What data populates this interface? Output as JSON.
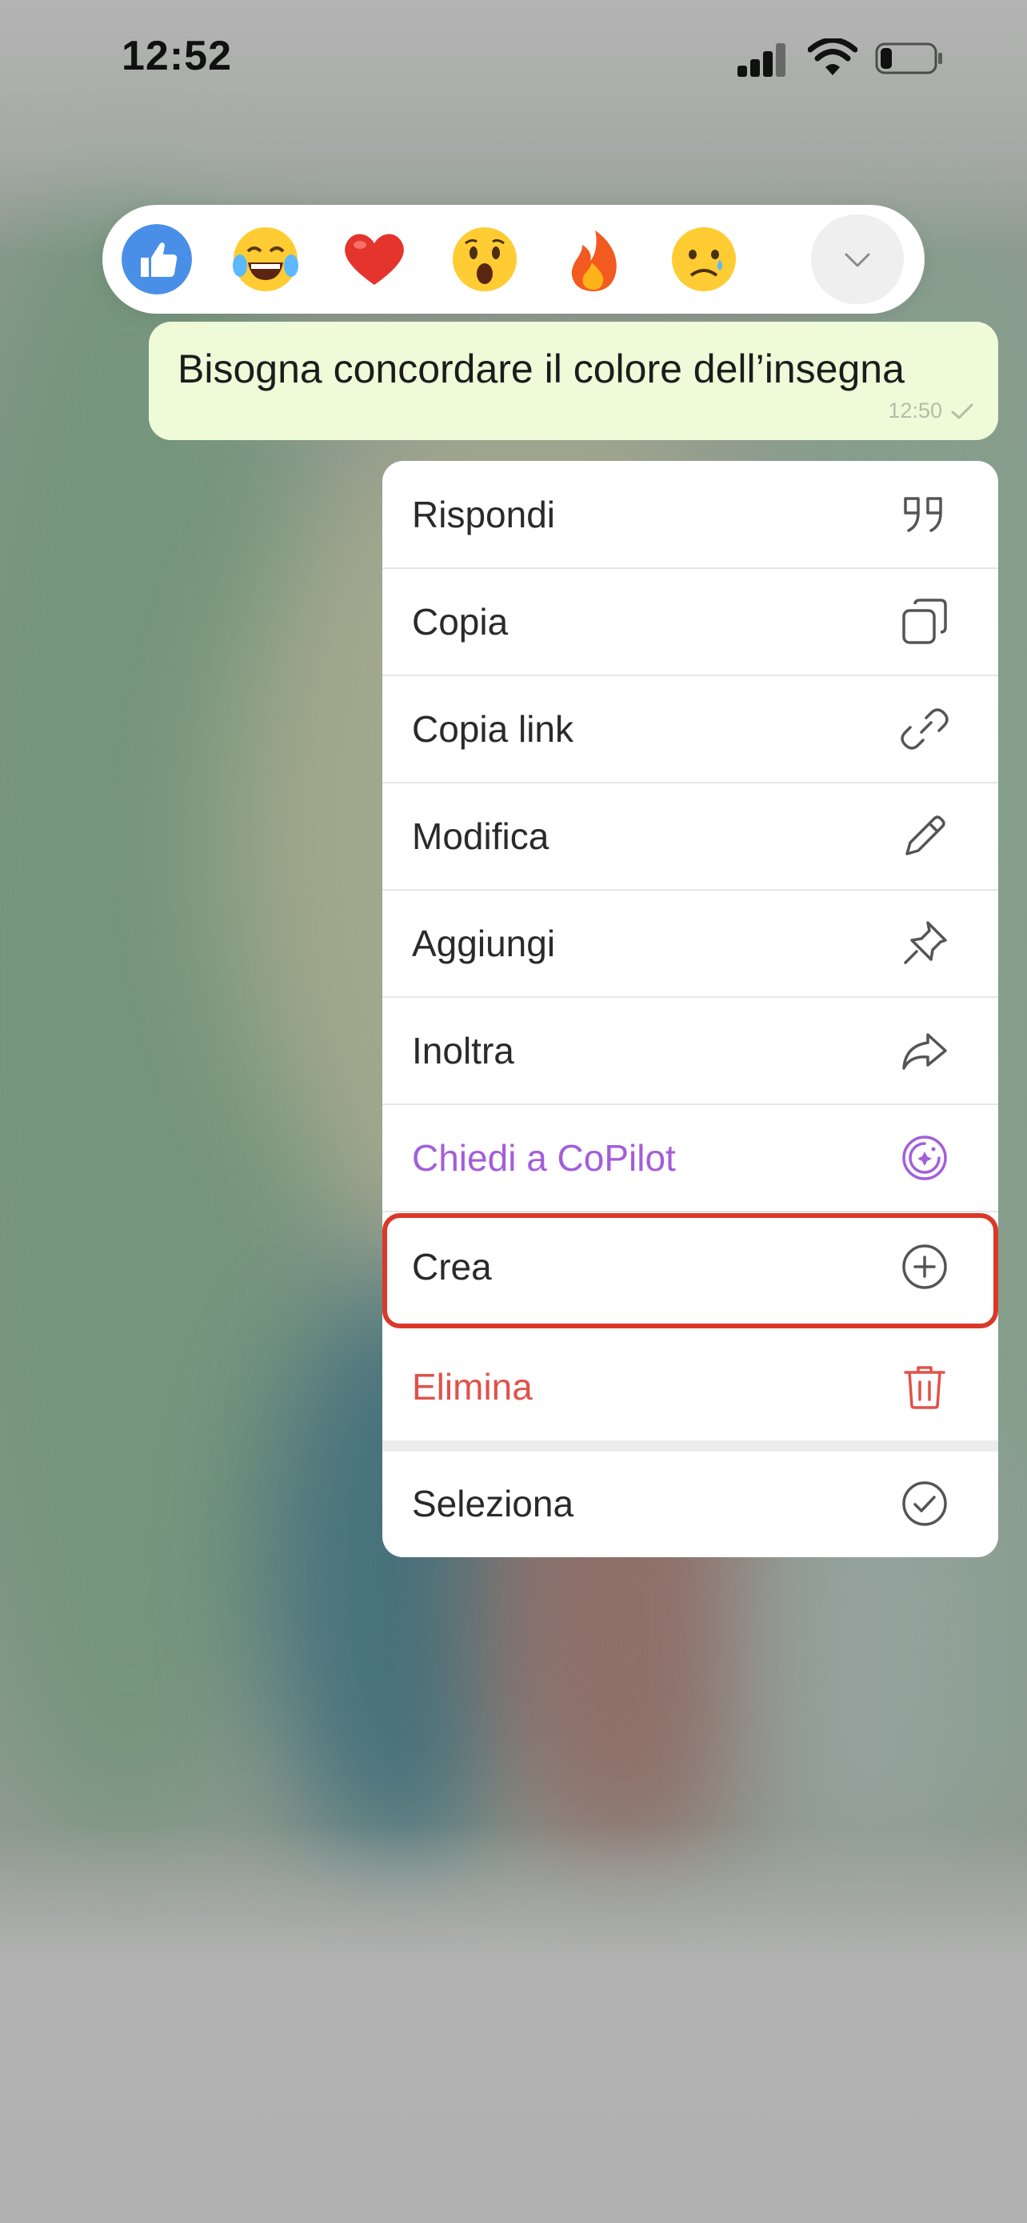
{
  "status_bar": {
    "time": "12:52"
  },
  "reactions": [
    {
      "name": "thumbs-up",
      "glyph": "👍"
    },
    {
      "name": "face-with-tears-of-joy",
      "glyph": "😂"
    },
    {
      "name": "red-heart",
      "glyph": "❤️"
    },
    {
      "name": "face-with-open-mouth",
      "glyph": "😮"
    },
    {
      "name": "fire",
      "glyph": "🔥"
    },
    {
      "name": "sad-face",
      "glyph": "😥"
    }
  ],
  "message": {
    "text": "Bisogna concordare il colore dell’insegna",
    "time": "12:50",
    "bubble_color": "#eefad8"
  },
  "menu": {
    "items": [
      {
        "label": "Rispondi",
        "icon": "quote-icon",
        "color": "#2a2a2a"
      },
      {
        "label": "Copia",
        "icon": "copy-icon",
        "color": "#2a2a2a"
      },
      {
        "label": "Copia link",
        "icon": "link-icon",
        "color": "#2a2a2a"
      },
      {
        "label": "Modifica",
        "icon": "pencil-icon",
        "color": "#2a2a2a"
      },
      {
        "label": "Aggiungi",
        "icon": "pin-icon",
        "color": "#2a2a2a"
      },
      {
        "label": "Inoltra",
        "icon": "forward-icon",
        "color": "#2a2a2a"
      },
      {
        "label": "Chiedi a CoPilot",
        "icon": "copilot-icon",
        "color": "#a35ed9"
      },
      {
        "label": "Crea",
        "icon": "plus-circle-icon",
        "color": "#2a2a2a"
      },
      {
        "label": "Elimina",
        "icon": "trash-icon",
        "color": "#e0524a"
      },
      {
        "label": "Seleziona",
        "icon": "check-circle-icon",
        "color": "#2a2a2a"
      }
    ]
  },
  "colors": {
    "highlight": "#d9392a",
    "copilot": "#a35ed9",
    "danger": "#e0524a"
  }
}
